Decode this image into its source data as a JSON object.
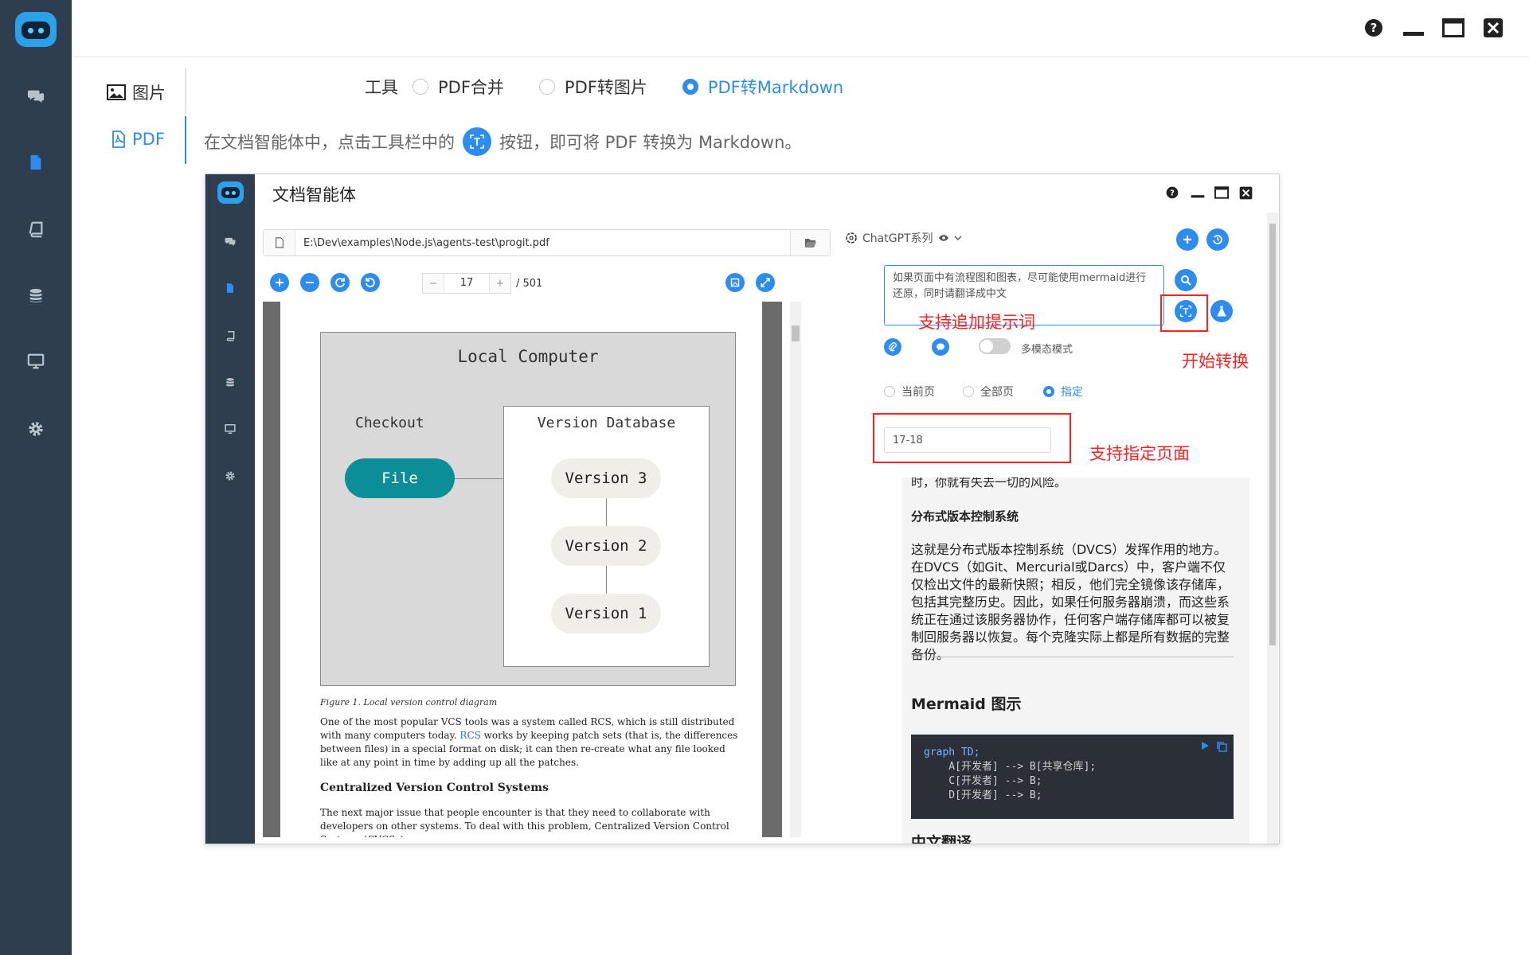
{
  "app": {
    "nav": [
      "chat-icon",
      "document-icon",
      "book-icon",
      "database-icon",
      "monitor-icon",
      "gear-icon"
    ]
  },
  "tabs": [
    {
      "label": "图片",
      "icon": "image-icon"
    },
    {
      "label": "PDF",
      "icon": "pdf-icon",
      "active": true
    }
  ],
  "tools": {
    "label": "工具",
    "options": [
      "PDF合并",
      "PDF转图片",
      "PDF转Markdown"
    ],
    "selected": "PDF转Markdown"
  },
  "description": {
    "before": "在文档智能体中，点击工具栏中的",
    "after": "按钮，即可将 PDF 转换为 Markdown。"
  },
  "inner": {
    "title": "文档智能体",
    "file_path": "E:\\Dev\\examples\\Node.js\\agents-test\\progit.pdf",
    "page": "17",
    "total": "/ 501",
    "pdf": {
      "diagram_title": "Local Computer",
      "checkout": "Checkout",
      "file": "File",
      "version_db": "Version Database",
      "versions": [
        "Version 3",
        "Version 2",
        "Version 1"
      ],
      "caption": "Figure 1. Local version control diagram",
      "para1_a": "One of the most popular VCS tools was a system called RCS, which is still distributed with many computers today. ",
      "para1_link": "RCS",
      "para1_b": " works by keeping patch sets (that is, the differences between files) in a special format on disk; it can then re-create what any file looked like at any point in time by adding up all the patches.",
      "heading": "Centralized Version Control Systems",
      "para2": "The next major issue that people encounter is that they need to collaborate with developers on other systems. To deal with this problem, Centralized Version Control Systems (CVCSs) were"
    },
    "model": "ChatGPT系列",
    "prompt": "如果页面中有流程图和图表，尽可能使用mermaid进行还原，同时请翻译成中文",
    "multimodal": "多模态模式",
    "page_options": [
      "当前页",
      "全部页",
      "指定"
    ],
    "page_selected": "指定",
    "range": "17-18",
    "annotations": {
      "prompt": "支持追加提示词",
      "start": "开始转换",
      "range": "支持指定页面"
    },
    "markdown": {
      "line0": "时，你就有失去一切的风险。",
      "heading1": "分布式版本控制系统",
      "para": "这就是分布式版本控制系统（DVCS）发挥作用的地方。在DVCS（如Git、Mercurial或Darcs）中，客户端不仅仅检出文件的最新快照；相反，他们完全镜像该存储库，包括其完整历史。因此，如果任何服务器崩溃，而这些系统正在通过该服务器协作，任何客户端存储库都可以被复制回服务器以恢复。每个克隆实际上都是所有数据的完整备份。",
      "heading2": "Mermaid 图示",
      "code": [
        "graph TD;",
        "    A[开发者] --> B[共享仓库];",
        "    C[开发者] --> B;",
        "    D[开发者] --> B;"
      ],
      "heading3": "中文翻译"
    }
  },
  "colors": {
    "accent": "#2d8cf0",
    "sidebar": "#2f3e4e",
    "annotation": "#ff2121"
  }
}
